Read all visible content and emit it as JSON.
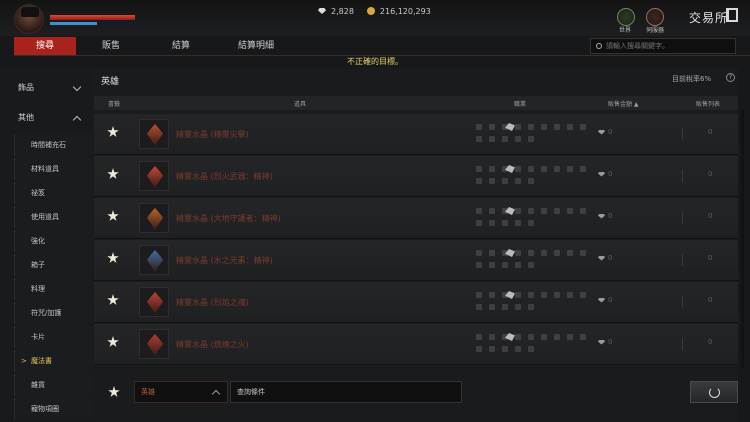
{
  "player": {
    "hp_fraction": 1.0,
    "mp_fraction": 0.55
  },
  "currency": {
    "gems": "2,828",
    "silver": "216,120,293"
  },
  "top_icons": {
    "world": "世界",
    "server": "伺服器"
  },
  "exchange_title": "交易所",
  "tabs": [
    "搜尋",
    "販售",
    "結算",
    "結算明細"
  ],
  "active_tab": 0,
  "notice": "不正確的目標。",
  "search": {
    "placeholder": "請輸入搜尋關鍵字。"
  },
  "sidebar": {
    "categories": [
      "飾品",
      "其他"
    ],
    "items": [
      "時間補充石",
      "材料道具",
      "祕笈",
      "使用道具",
      "強化",
      "箱子",
      "料理",
      "符咒/加護",
      "卡片",
      "魔法書",
      "雜貨",
      "寵物項圈"
    ],
    "selected_item": "魔法書"
  },
  "section": {
    "title": "英雄",
    "tax": "目前稅率6%",
    "tax_icon": "?"
  },
  "columns": {
    "favorite": "書籤",
    "item": "道具",
    "class": "職業",
    "price": "販售金額 ▲",
    "listing": "販售列表"
  },
  "rows": [
    {
      "name": "精靈水晶 (精靈尖擊)",
      "price": "0",
      "listing": "0",
      "color": "#b0522e"
    },
    {
      "name": "精靈水晶 (烈火武器：精神)",
      "price": "0",
      "listing": "0",
      "color": "#c24a36"
    },
    {
      "name": "精靈水晶 (大地守護者：精神)",
      "price": "0",
      "listing": "0",
      "color": "#b8662e"
    },
    {
      "name": "精靈水晶 (水之元素：精神)",
      "price": "0",
      "listing": "0",
      "color": "#3f6fa8"
    },
    {
      "name": "精靈水晶 (烈焰之魂)",
      "price": "0",
      "listing": "0",
      "color": "#b8443a"
    },
    {
      "name": "精靈水晶 (燃燒之火)",
      "price": "0",
      "listing": "0",
      "color": "#b03e36"
    }
  ],
  "filter": {
    "dropdown": "英雄",
    "condition": "查詢條件"
  }
}
